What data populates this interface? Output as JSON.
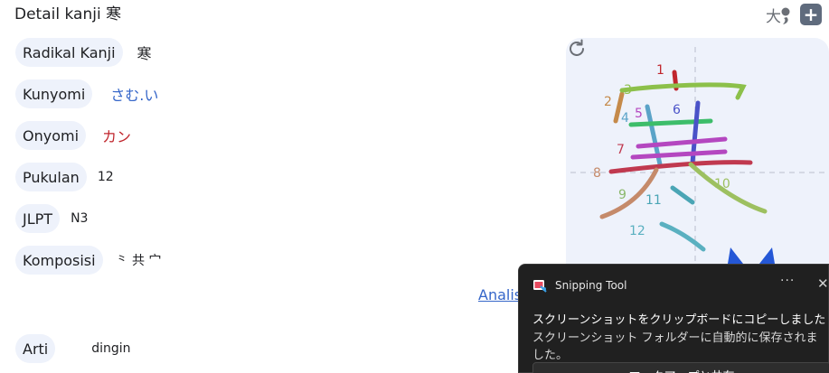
{
  "header": {
    "title": "Detail kanji 寒",
    "size_icon_glyph": "大",
    "add_glyph": "+"
  },
  "details": [
    {
      "label": "Radikal Kanji",
      "value": "寒"
    },
    {
      "label": "Kunyomi",
      "value": "さむ.い"
    },
    {
      "label": "Onyomi",
      "value": "カン"
    },
    {
      "label": "Pukulan",
      "value": "12"
    },
    {
      "label": "JLPT",
      "value": "N3"
    },
    {
      "label": "Komposisi",
      "value": "⺀ 共 宀"
    }
  ],
  "analysis_link": "Analis",
  "meaning": {
    "label": "Arti",
    "value": "dingin"
  },
  "stroke_order": {
    "kanji": "寒",
    "numbers": [
      "1",
      "2",
      "3",
      "4",
      "5",
      "6",
      "7",
      "8",
      "9",
      "10",
      "11",
      "12"
    ],
    "colors": [
      "#c0262d",
      "#c58a4a",
      "#8cc04a",
      "#5aa3c8",
      "#b447c0",
      "#4a52c8",
      "#c0394f",
      "#c58a6a",
      "#8ab86a",
      "#9dc060",
      "#4aa5b5",
      "#5ab0c0"
    ]
  },
  "toast": {
    "app": "Snipping Tool",
    "more": "···",
    "close": "✕",
    "message": "スクリーンショットをクリップボードにコピーしました",
    "detail": "スクリーンショット フォルダーに自動的に保存されました。",
    "action": "マークアップと共有"
  }
}
